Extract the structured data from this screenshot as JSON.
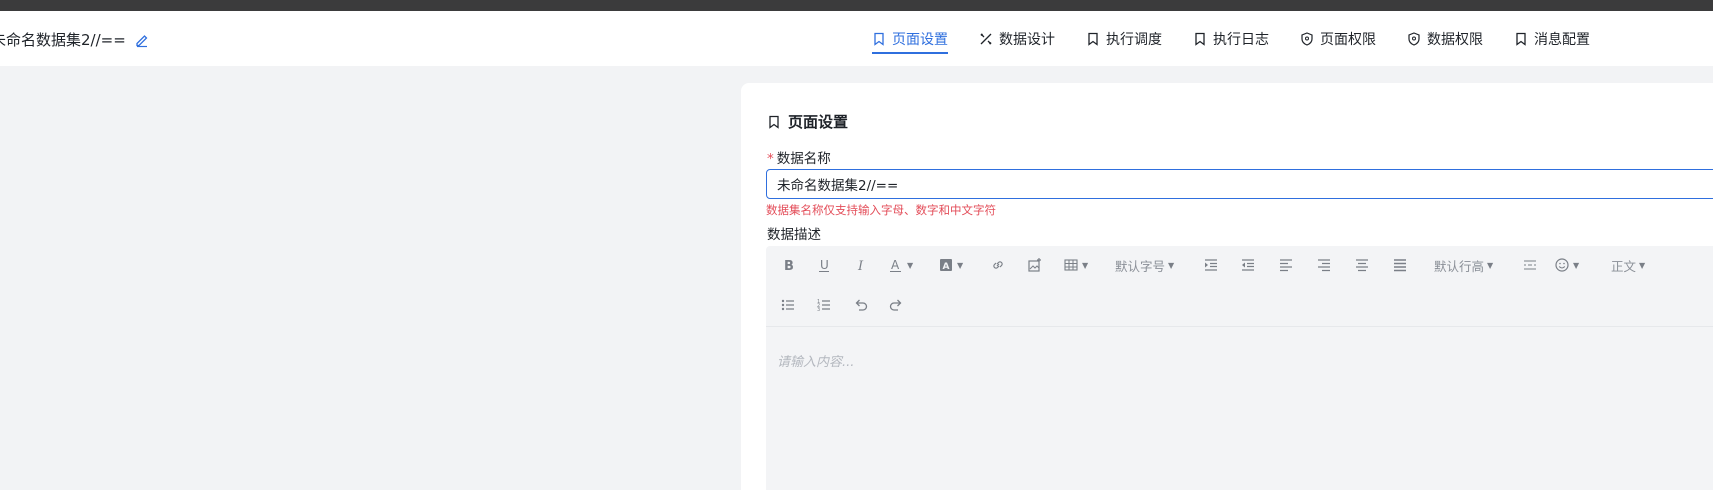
{
  "header": {
    "title": "未命名数据集2//==",
    "tabs": [
      {
        "label": "页面设置",
        "icon": "bookmark-icon",
        "active": true
      },
      {
        "label": "数据设计",
        "icon": "tools-icon",
        "active": false
      },
      {
        "label": "执行调度",
        "icon": "bookmark-icon",
        "active": false
      },
      {
        "label": "执行日志",
        "icon": "bookmark-icon",
        "active": false
      },
      {
        "label": "页面权限",
        "icon": "shield-icon",
        "active": false
      },
      {
        "label": "数据权限",
        "icon": "shield-icon",
        "active": false
      },
      {
        "label": "消息配置",
        "icon": "bookmark-icon",
        "active": false
      }
    ]
  },
  "form": {
    "section_title": "页面设置",
    "name_label": "数据名称",
    "required_mark": "*",
    "name_value": "未命名数据集2//==",
    "name_error": "数据集名称仅支持输入字母、数字和中文字符",
    "desc_label": "数据描述",
    "desc_placeholder": "请输入内容..."
  },
  "toolbar": {
    "font_size": "默认字号",
    "line_height": "默认行高",
    "paragraph": "正文",
    "icons": [
      "bold-icon",
      "underline-icon",
      "italic-icon",
      "font-color-icon",
      "background-color-icon",
      "link-icon",
      "image-icon",
      "table-icon",
      "indent-icon",
      "outdent-icon",
      "align-left-icon",
      "align-right-icon",
      "align-center-icon",
      "align-justify-icon",
      "divider-icon",
      "emoji-icon",
      "bullet-list-icon",
      "numbered-list-icon",
      "undo-icon",
      "redo-icon"
    ]
  },
  "colors": {
    "accent": "#2f6fde",
    "error": "#e34d59",
    "topbar": "#3b3b3c"
  }
}
